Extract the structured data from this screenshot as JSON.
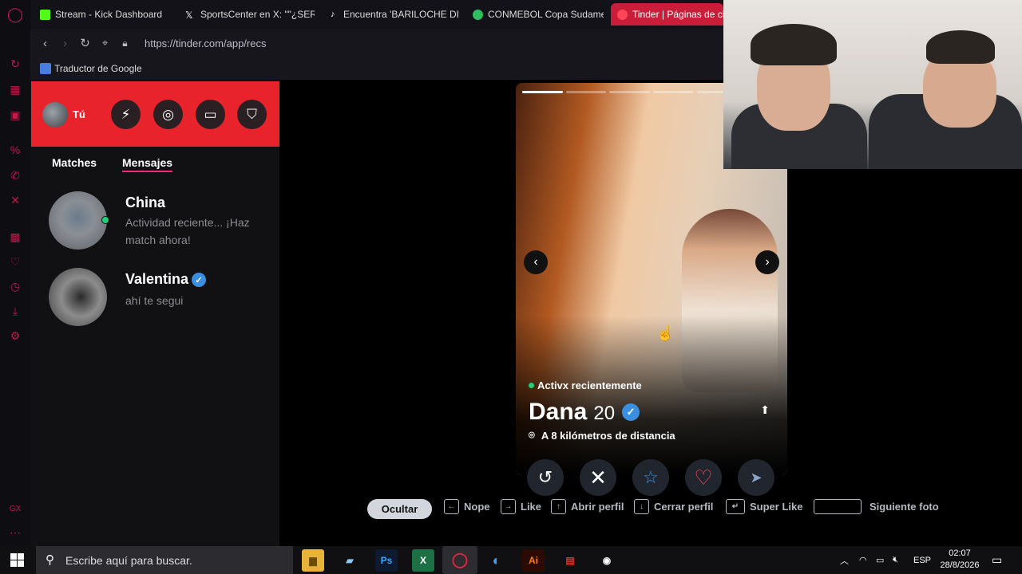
{
  "browser": {
    "tabs": [
      {
        "title": "Stream - Kick Dashboard",
        "favicon_color": "#53fc18"
      },
      {
        "title": "SportsCenter en X: \"\"¿SER",
        "favicon_color": "#ffffff"
      },
      {
        "title": "Encuentra 'BARILOCHE DIS",
        "favicon_color": "#ffffff"
      },
      {
        "title": "CONMEBOL Copa Sudame",
        "favicon_color": "#2dbe60"
      },
      {
        "title": "Tinder | Páginas de ci",
        "favicon_color": "#ff4458",
        "active": true
      }
    ],
    "url": "https://tinder.com/app/recs",
    "bookmark": "Traductor de Google"
  },
  "sidebar": {
    "you_label": "Tú",
    "tabs": [
      {
        "label": "Matches",
        "active": false
      },
      {
        "label": "Mensajes",
        "active": true
      }
    ],
    "conversations": [
      {
        "name": "China",
        "message": "Actividad reciente... ¡Haz match ahora!",
        "online": true,
        "verified": false
      },
      {
        "name": "Valentina",
        "message": "ahí te segui",
        "online": false,
        "verified": true
      }
    ]
  },
  "profile": {
    "status": "Activx recientemente",
    "name": "Dana",
    "age": "20",
    "verified": true,
    "distance": "A 8 kilómetros de distancia",
    "photo_count": 6,
    "current_photo": 1
  },
  "shortcuts": {
    "hide_label": "Ocultar",
    "items": [
      {
        "key": "←",
        "label": "Nope"
      },
      {
        "key": "→",
        "label": "Like"
      },
      {
        "key": "↑",
        "label": "Abrir perfil"
      },
      {
        "key": "↓",
        "label": "Cerrar perfil"
      },
      {
        "key": "↵",
        "label": "Super Like"
      },
      {
        "key": "space",
        "label": "Siguiente foto"
      }
    ]
  },
  "taskbar": {
    "search_placeholder": "Escribe aquí para buscar.",
    "language": "ESP",
    "time": "02:07",
    "date": "28/8/2026"
  },
  "colors": {
    "tinder_red": "#e8232b",
    "accent_pink": "#fd267d",
    "like_red": "#ff4458",
    "verified_blue": "#3b8fe0",
    "online_green": "#21d07a",
    "opera_red": "#c2184b"
  }
}
